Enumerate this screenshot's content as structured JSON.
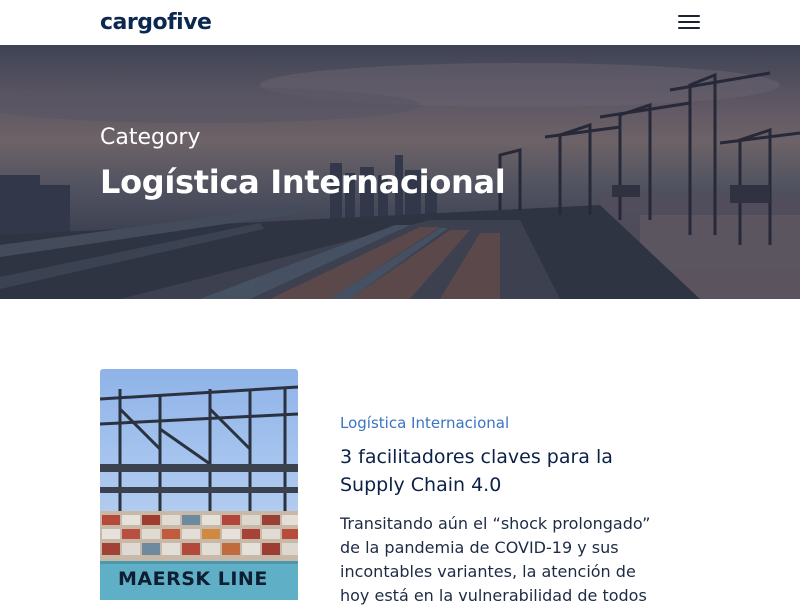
{
  "header": {
    "logo_text": "cargofive",
    "menu_icon": "hamburger-menu-icon"
  },
  "hero": {
    "category_label": "Category",
    "title": "Logística Internacional"
  },
  "post": {
    "image_text": "MAERSK LINE",
    "category": "Logística Internacional",
    "title": "3 facilitadores claves para la Supply Chain 4.0",
    "excerpt": "Transitando aún el “shock prolongado” de la pandemia de COVID-19 y sus incontables variantes, la atención de hoy está en la vulnerabilidad de todos"
  },
  "colors": {
    "brand": "#0d2850",
    "accent": "#3a74c2"
  }
}
